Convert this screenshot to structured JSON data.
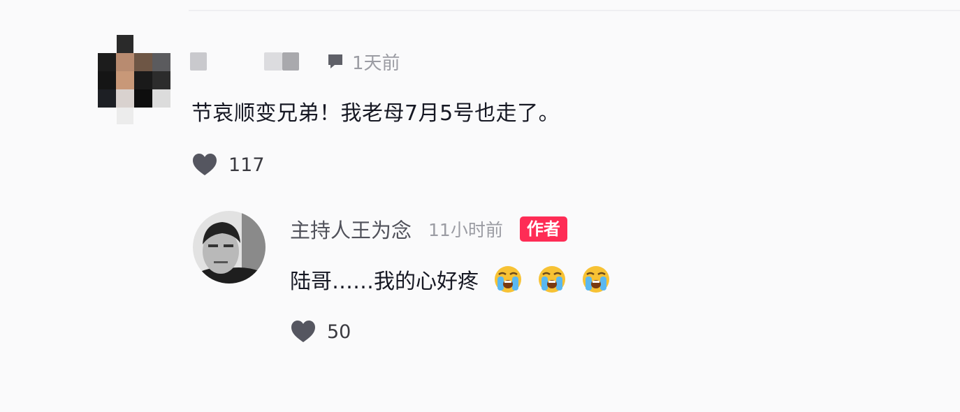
{
  "comment": {
    "time_ago": "1天前",
    "text": "节哀顺变兄弟！我老母7月5号也走了。",
    "likes": "117"
  },
  "reply": {
    "username": "主持人王为念",
    "time_ago": "11小时前",
    "author_badge": "作者",
    "text": "陆哥……我的心好疼",
    "emojis": [
      "loudly-crying-face",
      "loudly-crying-face",
      "loudly-crying-face"
    ],
    "likes": "50"
  },
  "colors": {
    "background": "#fafafb",
    "badge": "#fe2c55",
    "meta_text": "#9b9ca3",
    "heart": "#555660"
  }
}
